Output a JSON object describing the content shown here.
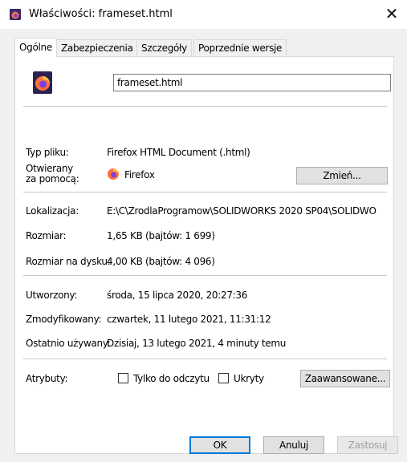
{
  "window": {
    "title": "Właściwości: frameset.html",
    "close_label": "✕"
  },
  "tabs": [
    {
      "label": "Ogólne",
      "active": true
    },
    {
      "label": "Zabezpieczenia",
      "active": false
    },
    {
      "label": "Szczegóły",
      "active": false
    },
    {
      "label": "Poprzednie wersje",
      "active": false
    }
  ],
  "general": {
    "file_name": "frameset.html",
    "file_type_label": "Typ pliku:",
    "file_type_value": "Firefox HTML Document (.html)",
    "opens_with_label_1": "Otwierany",
    "opens_with_label_2": "za pomocą:",
    "opens_with_value": "Firefox",
    "change_button": "Zmień...",
    "location_label": "Lokalizacja:",
    "location_value": "E:\\C\\ZrodlaProgramow\\SOLIDWORKS 2020 SP04\\SOLIDWO",
    "size_label": "Rozmiar:",
    "size_value": "1,65 KB (bajtów: 1 699)",
    "size_on_disk_label": "Rozmiar na dysku:",
    "size_on_disk_value": "4,00 KB (bajtów: 4 096)",
    "created_label": "Utworzony:",
    "created_value": "środa, 15 lipca 2020, 20:27:36",
    "modified_label": "Zmodyfikowany:",
    "modified_value": "czwartek, 11 lutego 2021, 11:31:12",
    "accessed_label": "Ostatnio używany:",
    "accessed_value": "Dzisiaj, 13 lutego 2021, 4 minuty temu",
    "attributes_label": "Atrybuty:",
    "readonly_label": "Tylko do odczytu",
    "readonly_checked": false,
    "hidden_label": "Ukryty",
    "hidden_checked": false,
    "advanced_button": "Zaawansowane..."
  },
  "footer": {
    "ok": "OK",
    "cancel": "Anuluj",
    "apply": "Zastosuj"
  },
  "colors": {
    "accent": "#0078d7",
    "firefox_orange": "#ff7139",
    "firefox_purple": "#7542e5"
  }
}
